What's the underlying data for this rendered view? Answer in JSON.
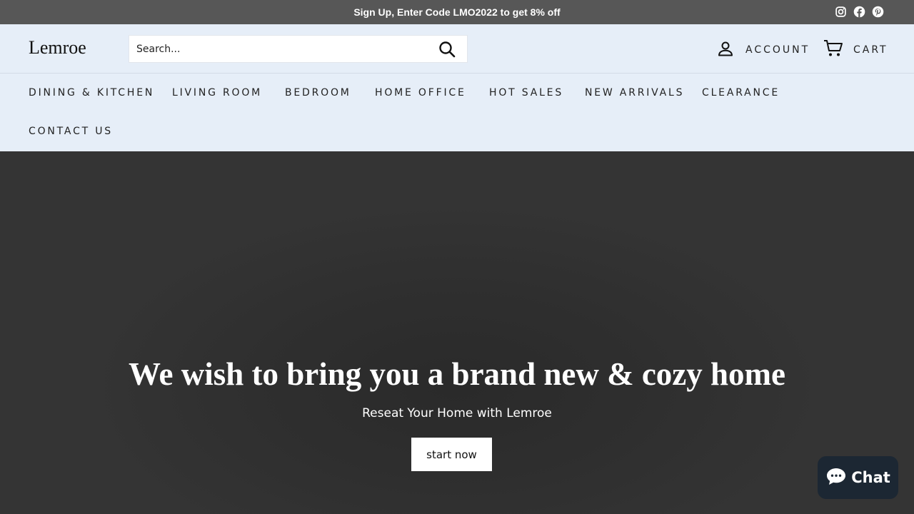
{
  "announcement": {
    "text": "Sign Up, Enter Code LMO2022 to get 8% off"
  },
  "social": [
    "instagram-icon",
    "facebook-icon",
    "pinterest-icon"
  ],
  "header": {
    "logo": "Lemroe",
    "search_placeholder": "Search...",
    "account_label": "ACCOUNT",
    "cart_label": "CART"
  },
  "nav": {
    "items": [
      "DINING & KITCHEN",
      "LIVING ROOM",
      "BEDROOM",
      "HOME OFFICE",
      "HOT SALES",
      "NEW ARRIVALS",
      "CLEARANCE",
      "CONTACT US"
    ]
  },
  "hero": {
    "title": "We wish to bring you a brand new & cozy home",
    "subtitle": "Reseat Your Home with Lemroe",
    "button_label": "start now"
  },
  "chat": {
    "label": "Chat"
  },
  "colors": {
    "announcement_bg": "#575757",
    "header_bg": "#e6eef8",
    "hero_bg": "#333333",
    "chat_bg": "#1c2733"
  }
}
